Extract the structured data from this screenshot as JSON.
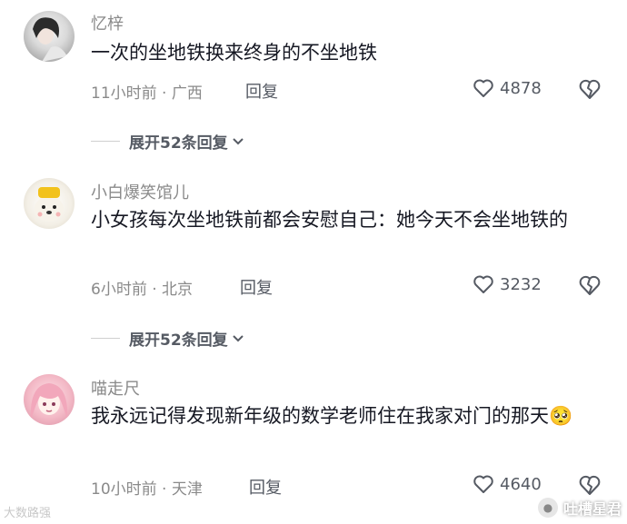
{
  "comments": [
    {
      "username": "忆梓",
      "text": "一次的坐地铁换来终身的不坐地铁",
      "meta": "11小时前 · 广西",
      "reply_label": "回复",
      "likes": "4878",
      "expand_label": "展开52条回复"
    },
    {
      "username": "小白爆笑馆儿",
      "text": "小女孩每次坐地铁前都会安慰自己：她今天不会坐地铁的",
      "meta": "6小时前 · 北京",
      "reply_label": "回复",
      "likes": "3232",
      "expand_label": "展开52条回复"
    },
    {
      "username": "喵走尺",
      "text": "我永远记得发现新年级的数学老师住在我家对门的那天🥺",
      "meta": "10小时前 · 天津",
      "reply_label": "回复",
      "likes": "4640"
    }
  ],
  "watermarks": {
    "left": "大数路强",
    "right": "吐槽星君"
  },
  "colors": {
    "text": "#161823",
    "muted": "#8a8a8a",
    "action": "#555a63"
  }
}
